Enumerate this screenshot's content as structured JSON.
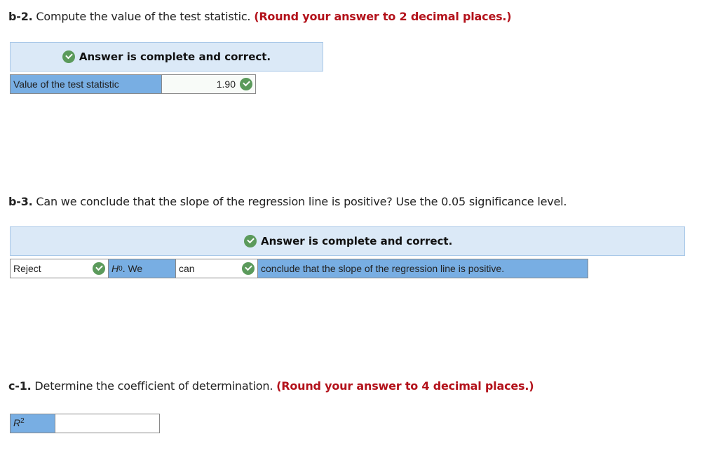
{
  "b2": {
    "label": "b-2.",
    "question": " Compute the value of the test statistic. ",
    "hint": "(Round your answer to 2 decimal places.)",
    "banner": "Answer is complete and correct.",
    "row": {
      "label": "Value of the test statistic",
      "value": "1.90",
      "status": "correct"
    }
  },
  "b3": {
    "label": "b-3.",
    "question": " Can we conclude that the slope of the regression line is positive? Use the 0.05 significance level.",
    "banner": "Answer is complete and correct.",
    "select1": {
      "value": "Reject",
      "status": "correct"
    },
    "h0": {
      "symbol": "H",
      "subscript": "0",
      "suffix": ". We"
    },
    "select2": {
      "value": "can",
      "status": "correct"
    },
    "conclusion": "conclude that the slope of the regression line is positive."
  },
  "c1": {
    "label": "c-1.",
    "question": " Determine the coefficient of determination. ",
    "hint": "(Round your answer to 4 decimal places.)",
    "row": {
      "symbol": "R",
      "superscript": "2",
      "value": ""
    }
  }
}
